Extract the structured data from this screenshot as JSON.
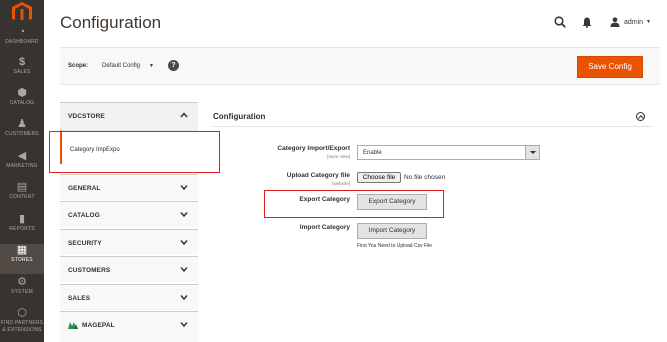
{
  "menu": {
    "items": [
      {
        "key": "dashboard",
        "label": "DASHBOARD",
        "glyph": "◔"
      },
      {
        "key": "sales",
        "label": "SALES",
        "glyph": "$"
      },
      {
        "key": "catalog",
        "label": "CATALOG",
        "glyph": "⬢"
      },
      {
        "key": "customers",
        "label": "CUSTOMERS",
        "glyph": "♟"
      },
      {
        "key": "marketing",
        "label": "MARKETING",
        "glyph": "◀"
      },
      {
        "key": "content",
        "label": "CONTENT",
        "glyph": "▤"
      },
      {
        "key": "reports",
        "label": "REPORTS",
        "glyph": "▮"
      },
      {
        "key": "stores",
        "label": "STORES",
        "glyph": "▦"
      },
      {
        "key": "system",
        "label": "SYSTEM",
        "glyph": "⚙"
      },
      {
        "key": "partners",
        "label": "FIND PARTNERS & EXTENSIONS",
        "glyph": "⬡"
      }
    ],
    "active": "stores"
  },
  "header": {
    "title": "Configuration",
    "user": "admin"
  },
  "scope": {
    "label": "Scope:",
    "value": "Default Config",
    "help": "?",
    "save_label": "Save Config"
  },
  "tabs": {
    "vdcstore": "VDCSTORE",
    "vdcstore_item": "Category ImpExpo",
    "general": "GENERAL",
    "catalog": "CATALOG",
    "security": "SECURITY",
    "customers": "CUSTOMERS",
    "sales": "SALES",
    "magepal": "MAGEPAL"
  },
  "section": {
    "title": "Configuration",
    "import_export_label": "Category Import/Export",
    "import_export_scope": "[store view]",
    "import_export_value": "Enable",
    "upload_label": "Upload Category file",
    "upload_scope": "[website]",
    "choose_file": "Choose file",
    "no_file": "No file chosen",
    "export_label": "Export Category",
    "export_button": "Export Category",
    "import_label": "Import Category",
    "import_button": "Import Category",
    "import_hint": "First You Need to Upload Csv File"
  },
  "colors": {
    "accent": "#eb5202",
    "menu_bg": "#373330",
    "highlight": "#e02020"
  }
}
